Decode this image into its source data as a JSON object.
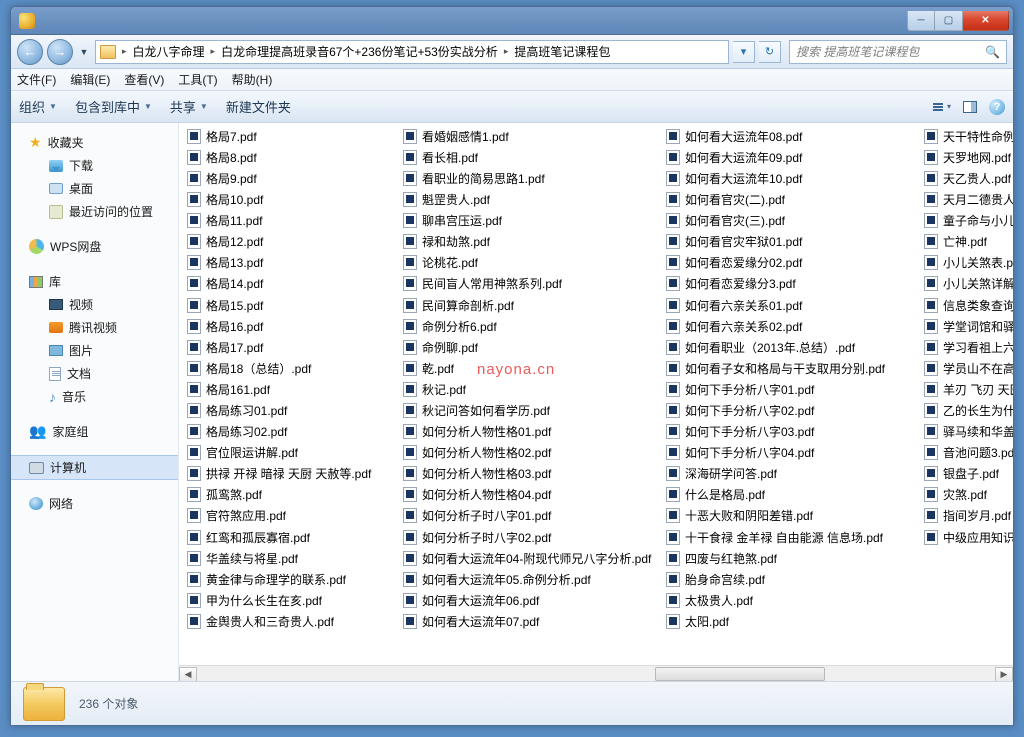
{
  "titlebar": {
    "min": "─",
    "max": "▢",
    "close": "✕"
  },
  "nav": {
    "back": "←",
    "fwd": "→",
    "drop": "▼",
    "refresh": "↻"
  },
  "breadcrumb": {
    "c1": "白龙八字命理",
    "c2": "白龙命理提高班录音67个+236份笔记+53份实战分析",
    "c3": "提高班笔记课程包",
    "sep": "▸"
  },
  "search": {
    "placeholder": "搜索 提高班笔记课程包",
    "icon": "🔍"
  },
  "menu": {
    "file": "文件(F)",
    "edit": "编辑(E)",
    "view": "查看(V)",
    "tools": "工具(T)",
    "help": "帮助(H)"
  },
  "toolbar": {
    "organize": "组织",
    "include": "包含到库中",
    "share": "共享",
    "newfolder": "新建文件夹",
    "drop": "▼",
    "view_drop": "▾",
    "help": "?"
  },
  "sidebar": {
    "fav": "收藏夹",
    "downloads": "下载",
    "desktop": "桌面",
    "recent": "最近访问的位置",
    "wps": "WPS网盘",
    "lib": "库",
    "video": "视频",
    "tq": "腾讯视频",
    "pictures": "图片",
    "docs": "文档",
    "music": "音乐",
    "home": "家庭组",
    "computer": "计算机",
    "network": "网络"
  },
  "files": {
    "col1": [
      "格局7.pdf",
      "格局8.pdf",
      "格局9.pdf",
      "格局10.pdf",
      "格局11.pdf",
      "格局12.pdf",
      "格局13.pdf",
      "格局14.pdf",
      "格局15.pdf",
      "格局16.pdf",
      "格局17.pdf",
      "格局18（总结）.pdf",
      "格局161.pdf",
      "格局练习01.pdf",
      "格局练习02.pdf",
      "官位限运讲解.pdf",
      "拱禄 开禄 暗禄 天厨 天赦等.pdf",
      "孤鸾煞.pdf",
      "官符煞应用.pdf",
      "红鸾和孤辰寡宿.pdf",
      "华盖续与将星.pdf",
      "黄金律与命理学的联系.pdf",
      "甲为什么长生在亥.pdf",
      "金舆贵人和三奇贵人.pdf"
    ],
    "col2": [
      "看婚姻感情1.pdf",
      "看长相.pdf",
      "看职业的简易思路1.pdf",
      "魁罡贵人.pdf",
      "聊串宫压运.pdf",
      "禄和劫煞.pdf",
      "论桃花.pdf",
      "民间盲人常用神煞系列.pdf",
      "民间算命剖析.pdf",
      "命例分析6.pdf",
      "命例聊.pdf",
      "乾.pdf",
      "秋记.pdf",
      "秋记问答如何看学历.pdf",
      "如何分析人物性格01.pdf",
      "如何分析人物性格02.pdf",
      "如何分析人物性格03.pdf",
      "如何分析人物性格04.pdf",
      "如何分析子时八字01.pdf",
      "如何分析子时八字02.pdf",
      "如何看大运流年04-附现代师兄八字分析.pdf",
      "如何看大运流年05.命例分析.pdf",
      "如何看大运流年06.pdf",
      "如何看大运流年07.pdf"
    ],
    "col3": [
      "如何看大运流年08.pdf",
      "如何看大运流年09.pdf",
      "如何看大运流年10.pdf",
      "如何看官灾(二).pdf",
      "如何看官灾(三).pdf",
      "如何看官灾牢狱01.pdf",
      "如何看恋爱缘分02.pdf",
      "如何看恋爱缘分3.pdf",
      "如何看六亲关系01.pdf",
      "如何看六亲关系02.pdf",
      "如何看职业（2013年.总结）.pdf",
      "如何看子女和格局与干支取用分别.pdf",
      "如何下手分析八字01.pdf",
      "如何下手分析八字02.pdf",
      "如何下手分析八字03.pdf",
      "如何下手分析八字04.pdf",
      "深海研学问答.pdf",
      "什么是格局.pdf",
      "十恶大败和阴阳差错.pdf",
      "十干食禄 金羊禄 自由能源 信息场.pdf",
      "四废与红艳煞.pdf",
      "胎身命宫续.pdf",
      "太极贵人.pdf",
      "太阳.pdf"
    ],
    "col4": [
      "天干特性命例分析",
      "天罗地网.pdf",
      "天乙贵人.pdf",
      "天月二德贵人.pd",
      "童子命与小儿关",
      "亡神.pdf",
      "小儿关煞表.pdf",
      "小儿关煞详解.pd",
      "信息类象查询用.",
      "学堂词馆和驿马.",
      "学习看祖上六亲的",
      "学员山不在高问题",
      "羊刃 飞刃 天医.p",
      "乙的长生为什么",
      "驿马续和华盖.pd",
      "音池问题3.pdf",
      "银盘子.pdf",
      "灾煞.pdf",
      "指间岁月.pdf",
      "中级应用知识课程"
    ]
  },
  "watermark": "nayona.cn",
  "scroll": {
    "left": "◀",
    "right": "▶"
  },
  "status": {
    "count": "236 个对象"
  }
}
